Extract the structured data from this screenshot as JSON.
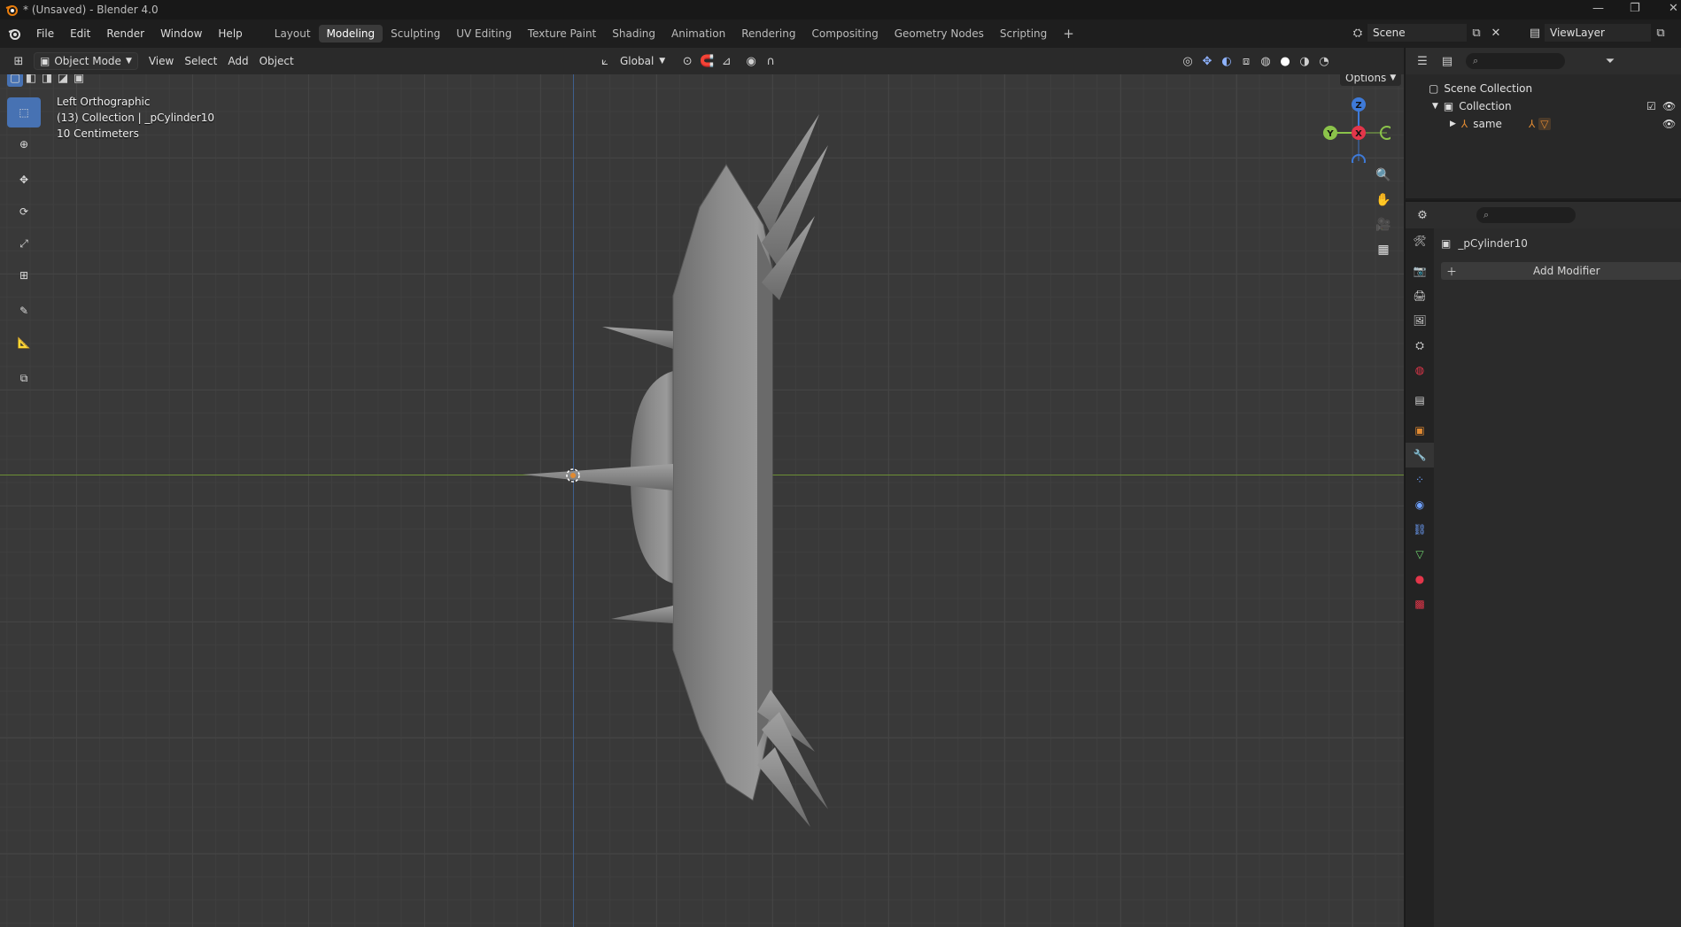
{
  "titlebar": {
    "title": "* (Unsaved) - Blender 4.0"
  },
  "menu": {
    "items": [
      "File",
      "Edit",
      "Render",
      "Window",
      "Help"
    ]
  },
  "workspaces": {
    "tabs": [
      "Layout",
      "Modeling",
      "Sculpting",
      "UV Editing",
      "Texture Paint",
      "Shading",
      "Animation",
      "Rendering",
      "Compositing",
      "Geometry Nodes",
      "Scripting"
    ],
    "active": "Modeling",
    "add": "+"
  },
  "scene": {
    "name": "Scene",
    "view_layer": "ViewLayer"
  },
  "viewport_header": {
    "mode": "Object Mode",
    "menus": [
      "View",
      "Select",
      "Add",
      "Object"
    ],
    "orientation": "Global",
    "options": "Options"
  },
  "viewport": {
    "view_name": "Left Orthographic",
    "collection_info": "(13) Collection | _pCylinder10",
    "scale": "10 Centimeters"
  },
  "gizmo": {
    "z": "Z",
    "y": "Y",
    "x": "X"
  },
  "outliner": {
    "scene_collection": "Scene Collection",
    "collection": "Collection",
    "object": "same"
  },
  "properties": {
    "object_name": "_pCylinder10",
    "add_modifier": "Add Modifier"
  },
  "colors": {
    "accent": "#4772b3",
    "x_axis": "#e3364a",
    "y_axis": "#8bc34a",
    "z_axis": "#3e7ad8",
    "object_orange": "#e08a32"
  }
}
